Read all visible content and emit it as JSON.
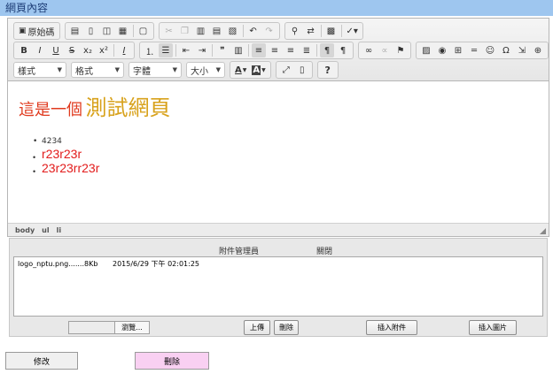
{
  "title": "網頁內容",
  "toolbar": {
    "source_label": "原始碼",
    "styles_label": "樣式",
    "format_label": "格式",
    "font_label": "字體",
    "size_label": "大小",
    "help_label": "?"
  },
  "content": {
    "heading_prefix": "這是一個",
    "heading_main": "測試網頁",
    "list_items": [
      "4234",
      "r23r23r",
      "23r23rr23r"
    ]
  },
  "path": [
    "body",
    "ul",
    "li"
  ],
  "attachments": {
    "manager_label": "附件管理員",
    "close_label": "關閉",
    "files": [
      {
        "name": "logo_nptu.png.......8Kb",
        "date": "2015/6/29 下午 02:01:25"
      }
    ],
    "browse_label": "瀏覽...",
    "upload_label": "上傳",
    "delete_label": "刪除",
    "insert_attachment_label": "插入附件",
    "insert_image_label": "插入圖片"
  },
  "actions": {
    "edit_label": "修改",
    "delete_label": "刪除"
  },
  "colors": {
    "titlebar": "#9ec6ef",
    "heading_red": "#e03a1e",
    "heading_gold": "#d8a21c",
    "list_red": "#e21b1b",
    "delete_button": "#f9d0f2"
  }
}
